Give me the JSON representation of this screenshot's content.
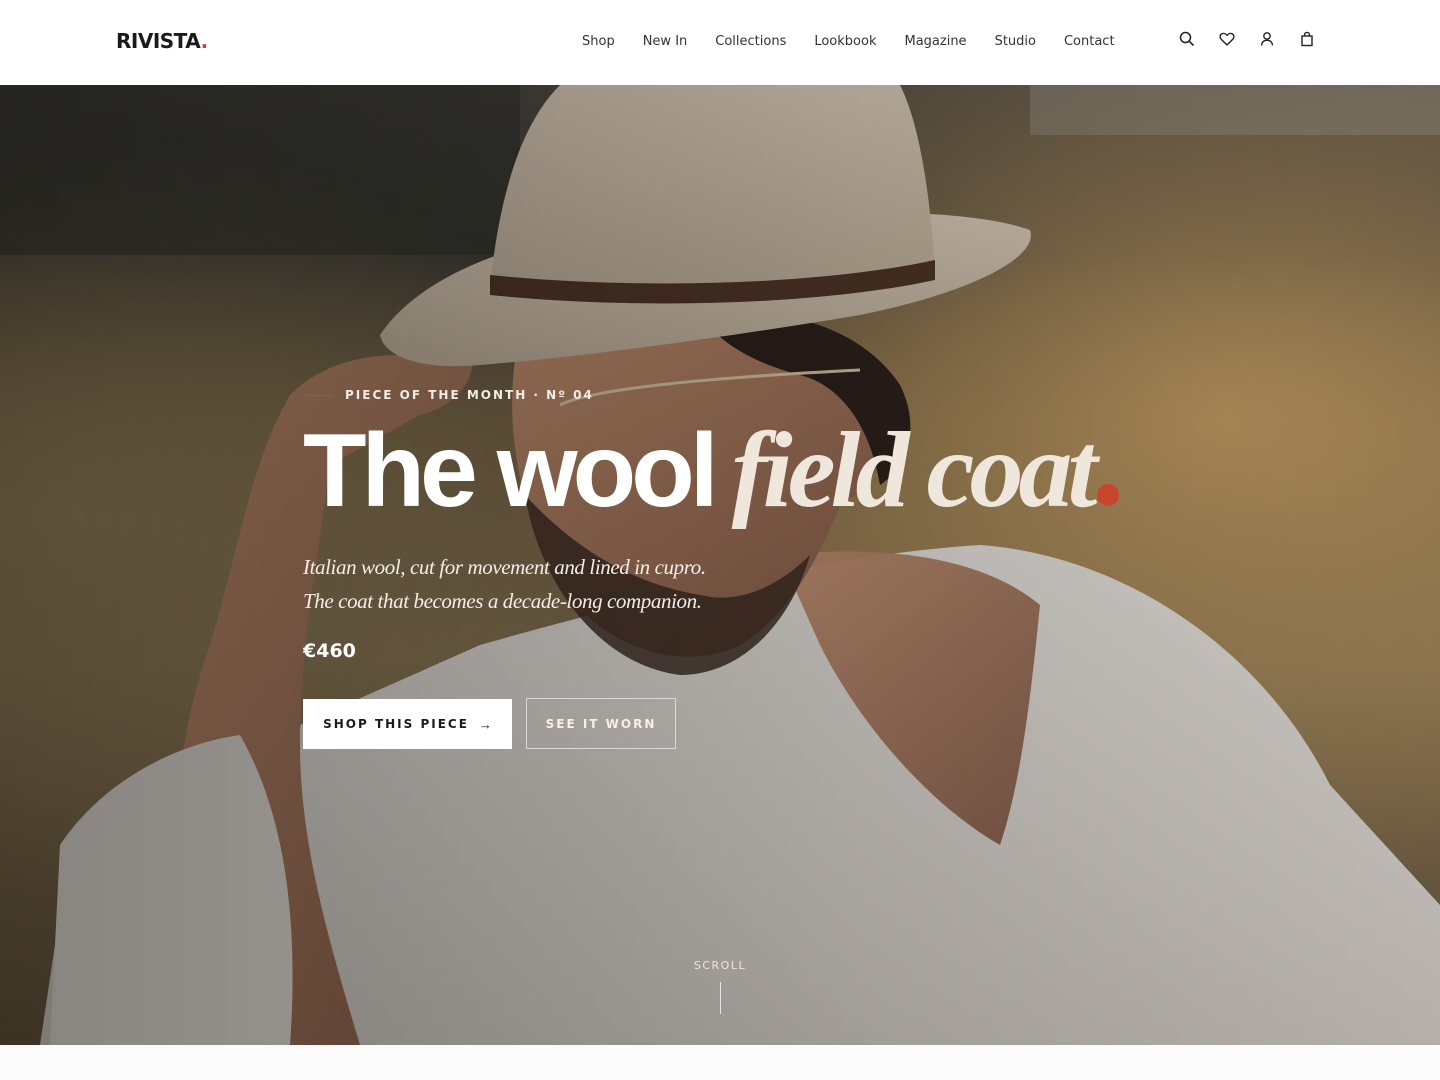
{
  "brand": {
    "name": "RIVISTA",
    "dot": ".",
    "accent_color": "#c9452a"
  },
  "nav": {
    "items": [
      {
        "label": "Shop"
      },
      {
        "label": "New In"
      },
      {
        "label": "Collections"
      },
      {
        "label": "Lookbook"
      },
      {
        "label": "Magazine"
      },
      {
        "label": "Studio"
      },
      {
        "label": "Contact"
      }
    ]
  },
  "header_icons": [
    "search-icon",
    "heart-icon",
    "user-icon",
    "bag-icon"
  ],
  "hero": {
    "eyebrow": "PIECE OF THE MONTH · Nº 04",
    "headline_sans": "The wool",
    "headline_serif": "field coat",
    "subtitle_lines": [
      "Italian wool, cut for movement and lined in cupro.",
      "The coat that becomes a decade-long companion."
    ],
    "price": "€460",
    "primary_button": {
      "label": "SHOP THIS PIECE",
      "arrow": "→"
    },
    "secondary_button": {
      "label": "SEE IT WORN"
    },
    "scroll_label": "SCROLL"
  }
}
